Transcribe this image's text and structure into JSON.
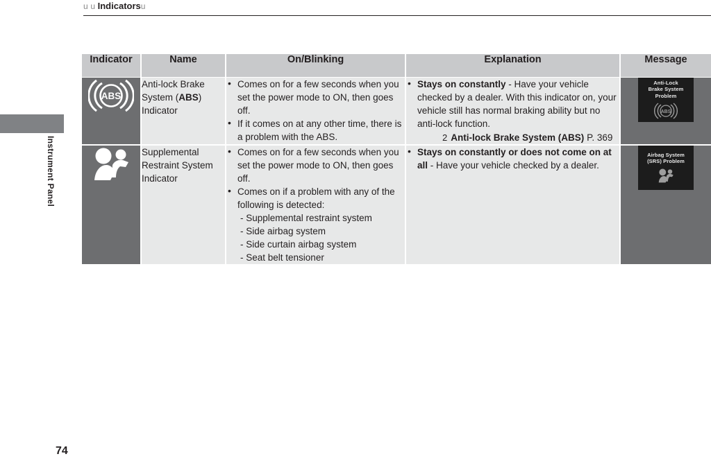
{
  "header": {
    "arrow_glyph": "u",
    "breadcrumb_prefix_1": "u",
    "breadcrumb_prefix_2": "u",
    "title": "Indicators",
    "arrow_suffix": "u"
  },
  "side": {
    "section_label": "Instrument Panel"
  },
  "page": {
    "number": "74"
  },
  "table": {
    "columns": [
      {
        "key": "indicator",
        "label": "Indicator"
      },
      {
        "key": "name",
        "label": "Name"
      },
      {
        "key": "onblinking",
        "label": "On/Blinking"
      },
      {
        "key": "explanation",
        "label": "Explanation"
      },
      {
        "key": "message",
        "label": "Message"
      }
    ],
    "rows": [
      {
        "indicator_icon": "abs-indicator-icon",
        "name_parts": {
          "before": "Anti-lock Brake System (",
          "bold": "ABS",
          "after": ") Indicator"
        },
        "name_plain": "Anti-lock Brake System (ABS) Indicator",
        "onblinking": [
          "Comes on for a few seconds when you set the power mode to ON, then goes off.",
          "If it comes on at any other time, there is a problem with the ABS."
        ],
        "explanation": {
          "bullet_bold": "Stays on constantly",
          "bullet_rest": " - Have your vehicle checked by a dealer. With this indicator on, your vehicle still has normal braking ability but no anti-lock function.",
          "xref_mark": "2",
          "xref_title": "Anti-lock Brake System (ABS)",
          "xref_page": "P. 369"
        },
        "message": {
          "screen_text": "Anti-Lock\nBrake System\nProblem",
          "screen_icon": "abs-message-icon"
        }
      },
      {
        "indicator_icon": "srs-indicator-icon",
        "name_parts": {
          "before": "Supplemental Restraint System Indicator",
          "bold": "",
          "after": ""
        },
        "name_plain": "Supplemental Restraint System Indicator",
        "onblinking": [
          "Comes on for a few seconds when you set the power mode to ON, then goes off.",
          "Comes on if a problem with any of the following is detected:"
        ],
        "onblinking_sublist": [
          "- Supplemental restraint system",
          "- Side airbag system",
          "- Side curtain airbag system",
          "- Seat belt tensioner"
        ],
        "explanation": {
          "bullet_bold": "Stays on constantly or does not come on at all",
          "bullet_rest": " - Have your vehicle checked by a dealer.",
          "xref_mark": "",
          "xref_title": "",
          "xref_page": ""
        },
        "message": {
          "screen_text": "Airbag System\n(SRS) Problem",
          "screen_icon": "srs-message-icon"
        }
      }
    ]
  },
  "colors": {
    "header_band": "#c8c9cb",
    "icon_cell": "#6d6e70",
    "text_cell": "#e7e8e8",
    "screen_bg": "#1c1c1c",
    "ink": "#231f20"
  }
}
